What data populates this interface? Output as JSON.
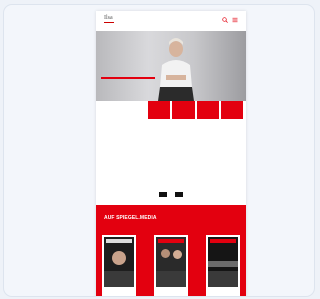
{
  "header": {
    "logo_text": "Ilsa",
    "icons": [
      "search-icon",
      "menu-icon"
    ]
  },
  "hero": {
    "caption_lines": [
      "",
      "",
      ""
    ]
  },
  "tiles": [
    "",
    "",
    "",
    ""
  ],
  "intro": {
    "text": ""
  },
  "body": {
    "text": ""
  },
  "buttons": {
    "primary": "",
    "secondary": ""
  },
  "magazines": {
    "title": "AUF SPIEGEL.MEDIA",
    "items": [
      {
        "label": ""
      },
      {
        "label": ""
      },
      {
        "label": ""
      }
    ]
  },
  "colors": {
    "accent": "#e3000f",
    "background": "#eef2f8"
  }
}
